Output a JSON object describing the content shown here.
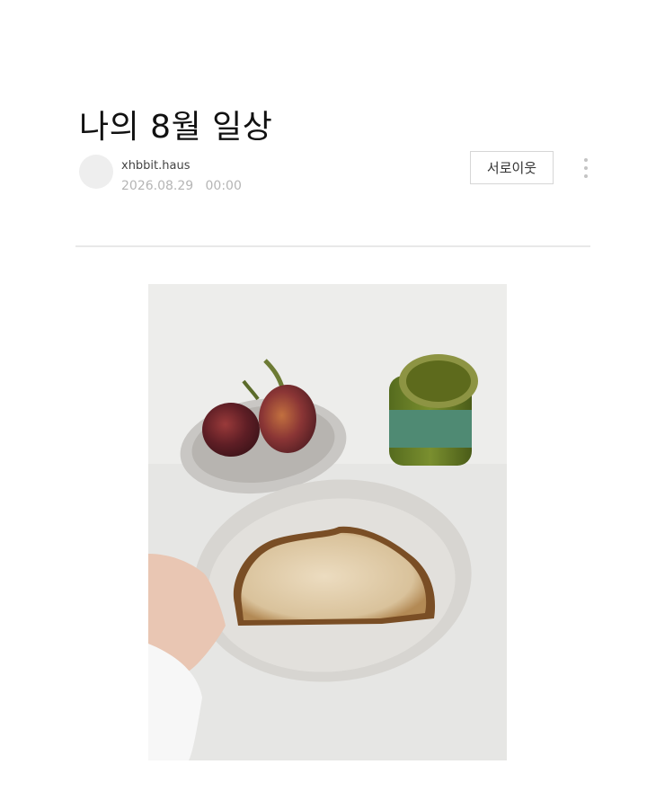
{
  "post": {
    "title": "나의 8월 일상",
    "author": "xhbbit.haus",
    "date": "2026.08.29   00:00",
    "neighbor_button": "서로이웃"
  },
  "icons": {
    "avatar": "profile-placeholder",
    "more": "more-vertical-icon"
  },
  "colors": {
    "background": "#ffffff",
    "divider": "#e8e8e8",
    "date_text": "#b5b5b5"
  }
}
